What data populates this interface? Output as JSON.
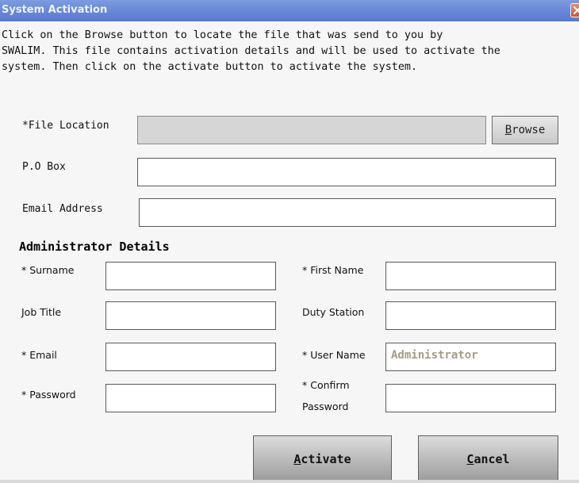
{
  "window": {
    "title": "System Activation",
    "close_icon": "close-icon"
  },
  "instructions": {
    "line1": "Click on the Browse button to locate the file that was send to you by",
    "line2": "SWALIM. This file contains activation details and will be used to activate the",
    "line3": "system. Then click on the activate button to activate the system."
  },
  "file_location": {
    "label": "*File Location",
    "value": "",
    "browse_label": "Browse",
    "browse_accel": "B",
    "browse_rest": "rowse"
  },
  "po_box": {
    "label": "P.O Box",
    "value": ""
  },
  "email_address": {
    "label": "Email Address",
    "value": ""
  },
  "admin": {
    "heading": "Administrator Details",
    "surname": {
      "label": "* Surname",
      "value": ""
    },
    "first_name": {
      "label": "* First Name",
      "value": ""
    },
    "job_title": {
      "label": "Job Title",
      "value": ""
    },
    "duty_station": {
      "label": "Duty Station",
      "value": ""
    },
    "email": {
      "label": "* Email",
      "value": ""
    },
    "user_name": {
      "label": "* User Name",
      "value": "Administrator"
    },
    "password": {
      "label": "* Password",
      "value": ""
    },
    "confirm_password": {
      "label_line1": "* Confirm",
      "label_line2": "Password",
      "value": ""
    }
  },
  "actions": {
    "activate_label": "Activate",
    "activate_accel": "A",
    "activate_rest": "ctivate",
    "cancel_label": "Cancel",
    "cancel_accel": "C",
    "cancel_rest": "ancel"
  },
  "colors": {
    "titlebar": "#6a8ad8",
    "window_bg": "#f6f6f6",
    "disabled_field": "#d6d6d6",
    "readonly_text": "#a49d86"
  }
}
